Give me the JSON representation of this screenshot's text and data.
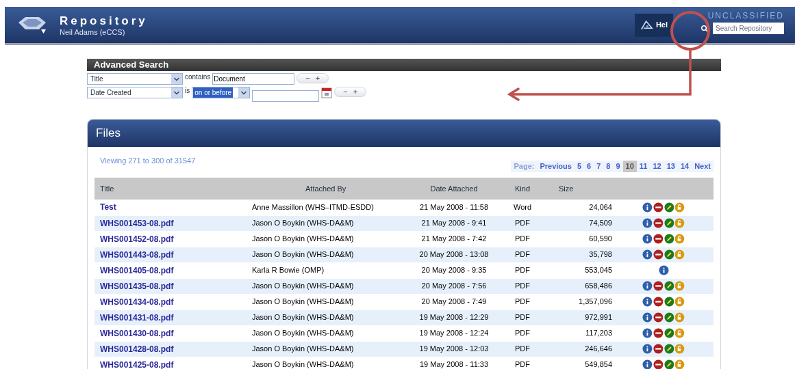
{
  "header": {
    "title": "Repository",
    "user": "Neil Adams (eCCS)",
    "help": "Hel",
    "classification": "UNCLASSIFIED",
    "search": {
      "placeholder": "Search Repository"
    }
  },
  "advanced_search": {
    "title": "Advanced Search",
    "rows": [
      {
        "kind": "text",
        "field": "Title",
        "operator": "contains",
        "value": "Document",
        "minus": "−",
        "plus": "+"
      },
      {
        "kind": "date",
        "field": "Date Created",
        "operator": "is",
        "condition": "on or before",
        "minus": "−",
        "plus": "+"
      }
    ]
  },
  "files": {
    "title": "Files",
    "viewing": "Viewing 271 to 300 of 31547",
    "pager": {
      "label": "Page:",
      "previous": "Previous",
      "next": "Next",
      "pages": [
        {
          "label": "5",
          "selected": false
        },
        {
          "label": "6",
          "selected": false
        },
        {
          "label": "7",
          "selected": false
        },
        {
          "label": "8",
          "selected": false
        },
        {
          "label": "9",
          "selected": false
        },
        {
          "label": "10",
          "selected": true
        },
        {
          "label": "11",
          "selected": false
        },
        {
          "label": "12",
          "selected": false
        },
        {
          "label": "13",
          "selected": false
        },
        {
          "label": "14",
          "selected": false
        }
      ]
    },
    "columns": [
      "Title",
      "Attached By",
      "Date Attached",
      "Kind",
      "Size"
    ],
    "rows": [
      {
        "title": "Test",
        "by": "Anne Massillon (WHS–ITMD-ESDD)",
        "date": "21 May 2008 - 11:58",
        "kind": "Word",
        "size": "24,064",
        "actions": [
          {
            "kind": "info"
          },
          {
            "kind": "remove"
          },
          {
            "kind": "edit"
          },
          {
            "kind": "lock"
          }
        ]
      },
      {
        "title": "WHS001453-08.pdf",
        "by": "Jason O Boykin (WHS-DA&M)",
        "date": "21 May 2008 - 9:41",
        "kind": "PDF",
        "size": "74,509",
        "actions": [
          {
            "kind": "info"
          },
          {
            "kind": "remove"
          },
          {
            "kind": "edit"
          },
          {
            "kind": "lock"
          }
        ]
      },
      {
        "title": "WHS001452-08.pdf",
        "by": "Jason O Boykin (WHS-DA&M)",
        "date": "21 May 2008 - 7:42",
        "kind": "PDF",
        "size": "60,590",
        "actions": [
          {
            "kind": "info"
          },
          {
            "kind": "remove"
          },
          {
            "kind": "edit"
          },
          {
            "kind": "lock"
          }
        ]
      },
      {
        "title": "WHS001443-08.pdf",
        "by": "Jason O Boykin (WHS-DA&M)",
        "date": "20 May 2008 - 13:08",
        "kind": "PDF",
        "size": "35,798",
        "actions": [
          {
            "kind": "info"
          },
          {
            "kind": "remove"
          },
          {
            "kind": "edit"
          },
          {
            "kind": "lock"
          }
        ]
      },
      {
        "title": "WHS001405-08.pdf",
        "by": "Karla R Bowie (OMP)",
        "date": "20 May 2008 - 9:35",
        "kind": "PDF",
        "size": "553,045",
        "actions": [
          {
            "kind": "info"
          }
        ]
      },
      {
        "title": "WHS001435-08.pdf",
        "by": "Jason O Boykin (WHS-DA&M)",
        "date": "20 May 2008 - 7:56",
        "kind": "PDF",
        "size": "658,486",
        "actions": [
          {
            "kind": "info"
          },
          {
            "kind": "remove"
          },
          {
            "kind": "edit"
          },
          {
            "kind": "lock"
          }
        ]
      },
      {
        "title": "WHS001434-08.pdf",
        "by": "Jason O Boykin (WHS-DA&M)",
        "date": "20 May 2008 - 7:49",
        "kind": "PDF",
        "size": "1,357,096",
        "actions": [
          {
            "kind": "info"
          },
          {
            "kind": "remove"
          },
          {
            "kind": "edit"
          },
          {
            "kind": "lock"
          }
        ]
      },
      {
        "title": "WHS001431-08.pdf",
        "by": "Jason O Boykin (WHS-DA&M)",
        "date": "19 May 2008 - 12:29",
        "kind": "PDF",
        "size": "972,991",
        "actions": [
          {
            "kind": "info"
          },
          {
            "kind": "remove"
          },
          {
            "kind": "edit"
          },
          {
            "kind": "lock"
          }
        ]
      },
      {
        "title": "WHS001430-08.pdf",
        "by": "Jason O Boykin (WHS-DA&M)",
        "date": "19 May 2008 - 12:24",
        "kind": "PDF",
        "size": "117,203",
        "actions": [
          {
            "kind": "info"
          },
          {
            "kind": "remove"
          },
          {
            "kind": "edit"
          },
          {
            "kind": "lock"
          }
        ]
      },
      {
        "title": "WHS001428-08.pdf",
        "by": "Jason O Boykin (WHS-DA&M)",
        "date": "19 May 2008 - 12:03",
        "kind": "PDF",
        "size": "246,646",
        "actions": [
          {
            "kind": "info"
          },
          {
            "kind": "remove"
          },
          {
            "kind": "edit"
          },
          {
            "kind": "lock"
          }
        ]
      },
      {
        "title": "WHS001425-08.pdf",
        "by": "Jason O Boykin (WHS-DA&M)",
        "date": "19 May 2008 - 11:33",
        "kind": "PDF",
        "size": "549,854",
        "actions": [
          {
            "kind": "info"
          },
          {
            "kind": "remove"
          },
          {
            "kind": "edit"
          },
          {
            "kind": "lock"
          }
        ]
      }
    ]
  }
}
